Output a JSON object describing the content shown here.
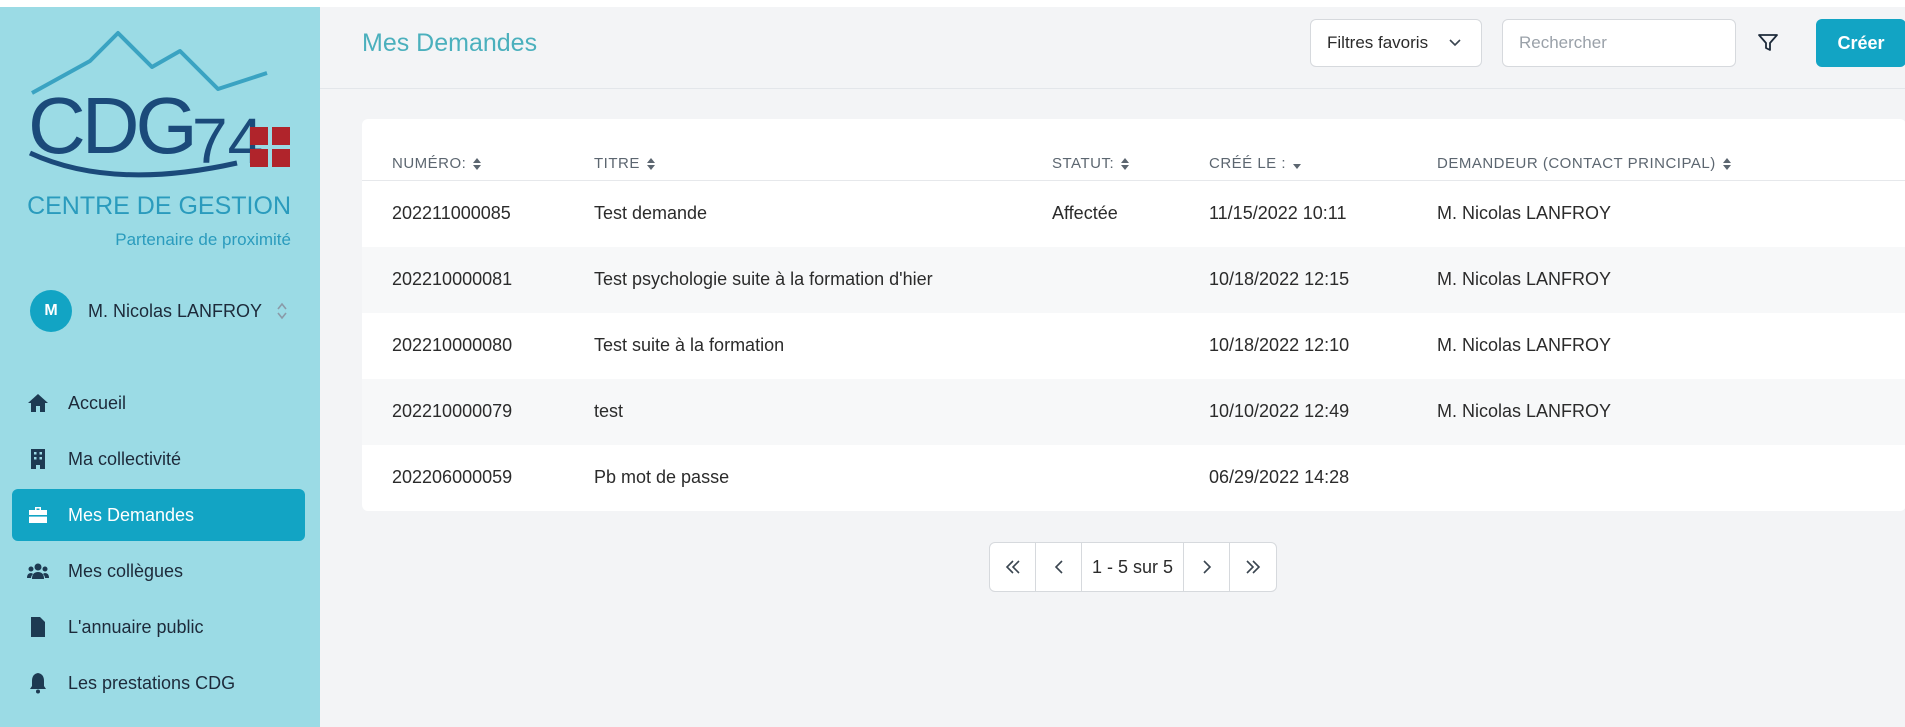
{
  "brand": {
    "logo_text": "CDG74",
    "name": "CENTRE DE GESTION",
    "tagline": "Partenaire de proximité"
  },
  "user": {
    "initial": "M",
    "name": "M. Nicolas LANFROY"
  },
  "sidebar": {
    "items": [
      {
        "label": "Accueil",
        "icon": "home-icon"
      },
      {
        "label": "Ma collectivité",
        "icon": "building-icon"
      },
      {
        "label": "Mes Demandes",
        "icon": "briefcase-icon",
        "active": true
      },
      {
        "label": "Mes collègues",
        "icon": "users-icon"
      },
      {
        "label": "L'annuaire public",
        "icon": "file-icon"
      },
      {
        "label": "Les prestations CDG",
        "icon": "bell-icon"
      }
    ]
  },
  "header": {
    "title": "Mes Demandes",
    "favorites_filter": "Filtres favoris",
    "search_placeholder": "Rechercher",
    "create_label": "Créer"
  },
  "table": {
    "columns": [
      "NUMÉRO:",
      "TITRE",
      "STATUT:",
      "CRÉÉ LE :",
      "DEMANDEUR (CONTACT PRINCIPAL)"
    ],
    "rows": [
      [
        "202211000085",
        "Test demande",
        "Affectée",
        "11/15/2022 10:11",
        "M. Nicolas LANFROY"
      ],
      [
        "202210000081",
        "Test psychologie suite à la formation d'hier",
        "",
        "10/18/2022 12:15",
        "M. Nicolas LANFROY"
      ],
      [
        "202210000080",
        "Test suite à la formation",
        "",
        "10/18/2022 12:10",
        "M. Nicolas LANFROY"
      ],
      [
        "202210000079",
        "test",
        "",
        "10/10/2022 12:49",
        "M. Nicolas LANFROY"
      ],
      [
        "202206000059",
        "Pb mot de passe",
        "",
        "06/29/2022 14:28",
        ""
      ]
    ]
  },
  "pagination": {
    "info": "1 - 5 sur 5"
  },
  "colors": {
    "sidebar_bg": "#9bdbe5",
    "accent": "#12a4c4",
    "title": "#4bb0bd",
    "logo_navy": "#1b4a7a",
    "logo_red": "#b0242b"
  }
}
